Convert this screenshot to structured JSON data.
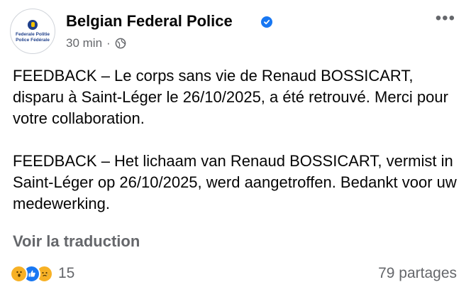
{
  "post": {
    "avatar_text_line1": "Federale Politie",
    "avatar_text_line2": "Police Fédérale",
    "page_name": "Belgian Federal Police",
    "time": "30 min",
    "separator": "·",
    "more_menu": "•••",
    "body": "FEEDBACK – Le corps sans vie de Renaud BOSSICART, disparu à Saint-Léger le 26/10/2025, a été retrouvé. Merci pour votre collaboration.\n\nFEEDBACK – Het lichaam van Renaud BOSSICART, vermist in Saint-Léger op 26/10/2025, werd aangetroffen. Bedankt voor uw medewerking.",
    "translate_link": "Voir la traduction",
    "reactions": {
      "icons": [
        "wow-icon",
        "like-icon",
        "sad-icon"
      ],
      "count": "15"
    },
    "shares": "79 partages"
  },
  "colors": {
    "text": "#050505",
    "secondary": "#65676b",
    "verified": "#1877f2",
    "brand_blue": "#1e3f8a"
  }
}
